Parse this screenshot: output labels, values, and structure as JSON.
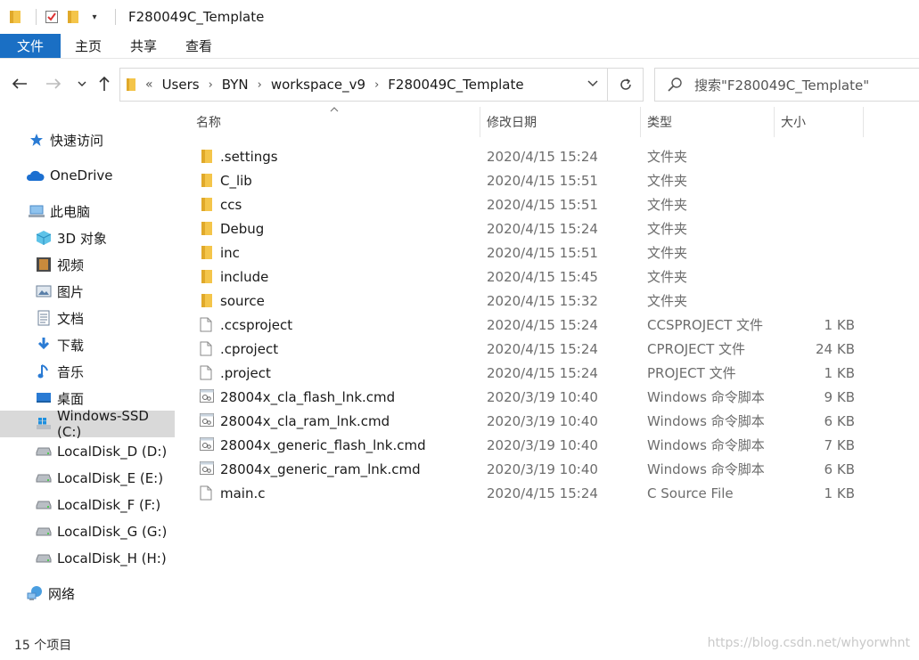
{
  "window": {
    "title": "F280049C_Template"
  },
  "ribbon": {
    "tabs": [
      "文件",
      "主页",
      "共享",
      "查看"
    ]
  },
  "address": {
    "crumbs": [
      "Users",
      "BYN",
      "workspace_v9",
      "F280049C_Template"
    ],
    "overflow": "«"
  },
  "search": {
    "placeholder": "搜索\"F280049C_Template\""
  },
  "sidebar": {
    "items": [
      {
        "label": "快速访问",
        "icon": "star-icon"
      },
      {
        "label": "OneDrive",
        "icon": "cloud-icon"
      },
      {
        "label": "此电脑",
        "icon": "computer-icon"
      },
      {
        "label": "3D 对象",
        "icon": "cube-icon"
      },
      {
        "label": "视频",
        "icon": "film-icon"
      },
      {
        "label": "图片",
        "icon": "picture-icon"
      },
      {
        "label": "文档",
        "icon": "document-icon"
      },
      {
        "label": "下载",
        "icon": "download-icon"
      },
      {
        "label": "音乐",
        "icon": "music-icon"
      },
      {
        "label": "桌面",
        "icon": "desktop-icon"
      },
      {
        "label": "Windows-SSD (C:)",
        "icon": "windows-drive-icon"
      },
      {
        "label": "LocalDisk_D (D:)",
        "icon": "drive-icon"
      },
      {
        "label": "LocalDisk_E (E:)",
        "icon": "drive-icon"
      },
      {
        "label": "LocalDisk_F (F:)",
        "icon": "drive-icon"
      },
      {
        "label": "LocalDisk_G (G:)",
        "icon": "drive-icon"
      },
      {
        "label": "LocalDisk_H (H:)",
        "icon": "drive-icon"
      },
      {
        "label": "网络",
        "icon": "network-icon"
      }
    ]
  },
  "columns": {
    "name": "名称",
    "date": "修改日期",
    "type": "类型",
    "size": "大小"
  },
  "files": [
    {
      "name": ".settings",
      "date": "2020/4/15 15:24",
      "type": "文件夹",
      "size": "",
      "kind": "folder"
    },
    {
      "name": "C_lib",
      "date": "2020/4/15 15:51",
      "type": "文件夹",
      "size": "",
      "kind": "folder"
    },
    {
      "name": "ccs",
      "date": "2020/4/15 15:51",
      "type": "文件夹",
      "size": "",
      "kind": "folder"
    },
    {
      "name": "Debug",
      "date": "2020/4/15 15:24",
      "type": "文件夹",
      "size": "",
      "kind": "folder"
    },
    {
      "name": "inc",
      "date": "2020/4/15 15:51",
      "type": "文件夹",
      "size": "",
      "kind": "folder"
    },
    {
      "name": "include",
      "date": "2020/4/15 15:45",
      "type": "文件夹",
      "size": "",
      "kind": "folder"
    },
    {
      "name": "source",
      "date": "2020/4/15 15:32",
      "type": "文件夹",
      "size": "",
      "kind": "folder"
    },
    {
      "name": ".ccsproject",
      "date": "2020/4/15 15:24",
      "type": "CCSPROJECT 文件",
      "size": "1 KB",
      "kind": "file"
    },
    {
      "name": ".cproject",
      "date": "2020/4/15 15:24",
      "type": "CPROJECT 文件",
      "size": "24 KB",
      "kind": "file"
    },
    {
      "name": ".project",
      "date": "2020/4/15 15:24",
      "type": "PROJECT 文件",
      "size": "1 KB",
      "kind": "file"
    },
    {
      "name": "28004x_cla_flash_lnk.cmd",
      "date": "2020/3/19 10:40",
      "type": "Windows 命令脚本",
      "size": "9 KB",
      "kind": "cmd"
    },
    {
      "name": "28004x_cla_ram_lnk.cmd",
      "date": "2020/3/19 10:40",
      "type": "Windows 命令脚本",
      "size": "6 KB",
      "kind": "cmd"
    },
    {
      "name": "28004x_generic_flash_lnk.cmd",
      "date": "2020/3/19 10:40",
      "type": "Windows 命令脚本",
      "size": "7 KB",
      "kind": "cmd"
    },
    {
      "name": "28004x_generic_ram_lnk.cmd",
      "date": "2020/3/19 10:40",
      "type": "Windows 命令脚本",
      "size": "6 KB",
      "kind": "cmd"
    },
    {
      "name": "main.c",
      "date": "2020/4/15 15:24",
      "type": "C Source File",
      "size": "1 KB",
      "kind": "file"
    }
  ],
  "status": {
    "count": "15 个项目"
  },
  "watermark": "https://blog.csdn.net/whyorwhnt",
  "colors": {
    "accent": "#1a6fc4",
    "folder": "#f4c54a",
    "selected": "#d9d9d9"
  }
}
